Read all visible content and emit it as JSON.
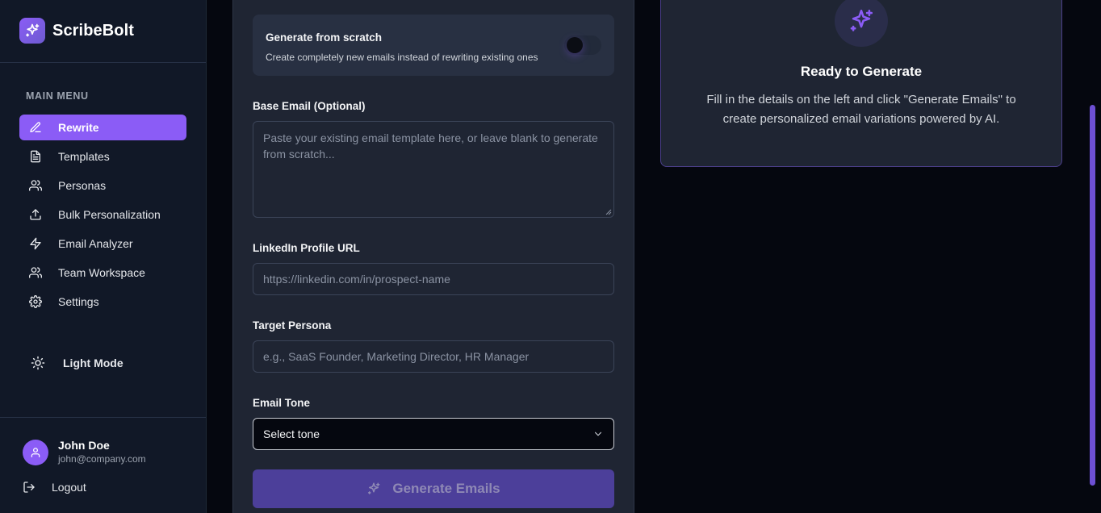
{
  "brand": {
    "name": "ScribeBolt"
  },
  "sidebar": {
    "menu_title": "MAIN MENU",
    "items": [
      {
        "label": "Rewrite",
        "icon": "pencil-icon",
        "active": true
      },
      {
        "label": "Templates",
        "icon": "file-text-icon",
        "active": false
      },
      {
        "label": "Personas",
        "icon": "users-icon",
        "active": false
      },
      {
        "label": "Bulk Personalization",
        "icon": "upload-icon",
        "active": false
      },
      {
        "label": "Email Analyzer",
        "icon": "zap-icon",
        "active": false
      },
      {
        "label": "Team Workspace",
        "icon": "users-icon",
        "active": false
      },
      {
        "label": "Settings",
        "icon": "gear-icon",
        "active": false
      }
    ],
    "theme_toggle": "Light Mode",
    "user": {
      "name": "John Doe",
      "email": "john@company.com"
    },
    "logout": "Logout"
  },
  "form": {
    "toggle": {
      "title": "Generate from scratch",
      "description": "Create completely new emails instead of rewriting existing ones",
      "enabled": false
    },
    "base_email": {
      "label": "Base Email (Optional)",
      "placeholder": "Paste your existing email template here, or leave blank to generate from scratch..."
    },
    "linkedin": {
      "label": "LinkedIn Profile URL",
      "placeholder": "https://linkedin.com/in/prospect-name"
    },
    "persona": {
      "label": "Target Persona",
      "placeholder": "e.g., SaaS Founder, Marketing Director, HR Manager"
    },
    "tone": {
      "label": "Email Tone",
      "selected": "Select tone"
    },
    "generate_label": "Generate Emails"
  },
  "ready": {
    "title": "Ready to Generate",
    "description": "Fill in the details on the left and click \"Generate Emails\" to create personalized email variations powered by AI."
  },
  "colors": {
    "accent": "#8b5cf6",
    "background": "#05070f",
    "sidebar": "#111827",
    "card": "#1f2533"
  }
}
